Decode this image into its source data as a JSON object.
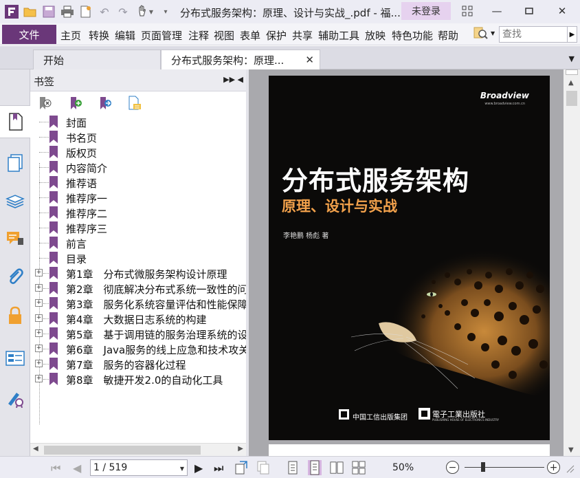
{
  "window": {
    "title": "分布式服务架构：原理、设计与实战_.pdf - 福...",
    "login_label": "未登录"
  },
  "quick_toolbar": {
    "icons": [
      "app-logo-icon",
      "open-folder-icon",
      "save-icon",
      "print-icon",
      "new-doc-icon",
      "undo-icon",
      "redo-icon",
      "hand-tool-icon",
      "customize-icon"
    ]
  },
  "menu": {
    "file": "文件",
    "items": [
      "主页",
      "转换",
      "编辑",
      "页面管理",
      "注释",
      "视图",
      "表单",
      "保护",
      "共享",
      "辅助工具",
      "放映",
      "特色功能",
      "帮助"
    ]
  },
  "search": {
    "placeholder": "查找"
  },
  "tabs": [
    {
      "label": "开始"
    },
    {
      "label": "分布式服务架构：原理..."
    }
  ],
  "bookmarks": {
    "panel_title": "书签",
    "items": [
      {
        "label": "封面",
        "expandable": false
      },
      {
        "label": "书名页",
        "expandable": false
      },
      {
        "label": "版权页",
        "expandable": false
      },
      {
        "label": "内容简介",
        "expandable": false
      },
      {
        "label": "推荐语",
        "expandable": false
      },
      {
        "label": "推荐序一",
        "expandable": false
      },
      {
        "label": "推荐序二",
        "expandable": false
      },
      {
        "label": "推荐序三",
        "expandable": false
      },
      {
        "label": "前言",
        "expandable": false
      },
      {
        "label": "目录",
        "expandable": false
      },
      {
        "label": "第1章　分布式微服务架构设计原理",
        "expandable": true
      },
      {
        "label": "第2章　彻底解决分布式系统一致性的问",
        "expandable": true
      },
      {
        "label": "第3章　服务化系统容量评估和性能保障",
        "expandable": true
      },
      {
        "label": "第4章　大数据日志系统的构建",
        "expandable": true
      },
      {
        "label": "第5章　基于调用链的服务治理系统的设",
        "expandable": true
      },
      {
        "label": "第6章　Java服务的线上应急和技术攻关",
        "expandable": true
      },
      {
        "label": "第7章　服务的容器化过程",
        "expandable": true
      },
      {
        "label": "第8章　敏捷开发2.0的自动化工具",
        "expandable": true
      }
    ]
  },
  "cover": {
    "brand": "Broadview",
    "brand_url": "www.broadview.com.cn",
    "title": "分布式服务架构",
    "subtitle": "原理、设计与实战",
    "authors": "李艳鹏 杨彪 著",
    "publisher1": "中国工信出版集团",
    "publisher2": "電子工業出版社",
    "publisher2_en": "PUBLISHING HOUSE OF ELECTRONICS INDUSTRY"
  },
  "status": {
    "page_value": "1 / 519",
    "zoom_label": "50%",
    "zoom_level": 0.5
  },
  "colors": {
    "accent": "#6a3779",
    "cover_subtitle": "#f2a14b",
    "bookmark_flag": "#7e4a8f"
  }
}
